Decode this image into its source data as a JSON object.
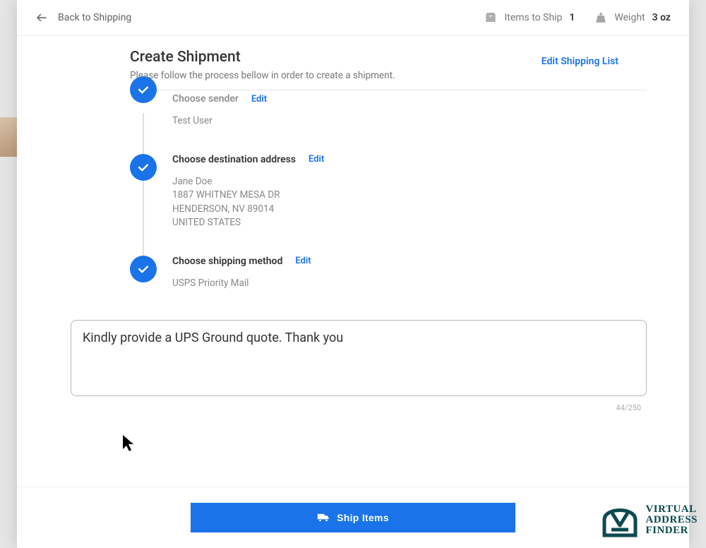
{
  "topbar": {
    "back_label": "Back to Shipping",
    "items_label": "Items to Ship",
    "items_count": "1",
    "weight_label": "Weight",
    "weight_value": "3 oz"
  },
  "header": {
    "title": "Create Shipment",
    "subtitle": "Please follow the process bellow in order to create a shipment.",
    "edit_list": "Edit Shipping List"
  },
  "steps": [
    {
      "title": "Choose sender",
      "edit": "Edit",
      "body_lines": [
        "Test User"
      ]
    },
    {
      "title": "Choose destination address",
      "edit": "Edit",
      "body_lines": [
        "Jane Doe",
        "1887 WHITNEY MESA DR",
        "HENDERSON, NV 89014",
        "UNITED STATES"
      ]
    },
    {
      "title": "Choose shipping method",
      "edit": "Edit",
      "body_lines": [
        "USPS Priority Mail"
      ]
    }
  ],
  "note": {
    "value": "Kindly provide a UPS Ground quote. Thank you",
    "counter": "44/250"
  },
  "footer": {
    "ship_label": "Ship Items"
  },
  "watermark": {
    "line1": "VIRTUAL",
    "line2": "ADDRESS",
    "line3": "FINDER"
  }
}
